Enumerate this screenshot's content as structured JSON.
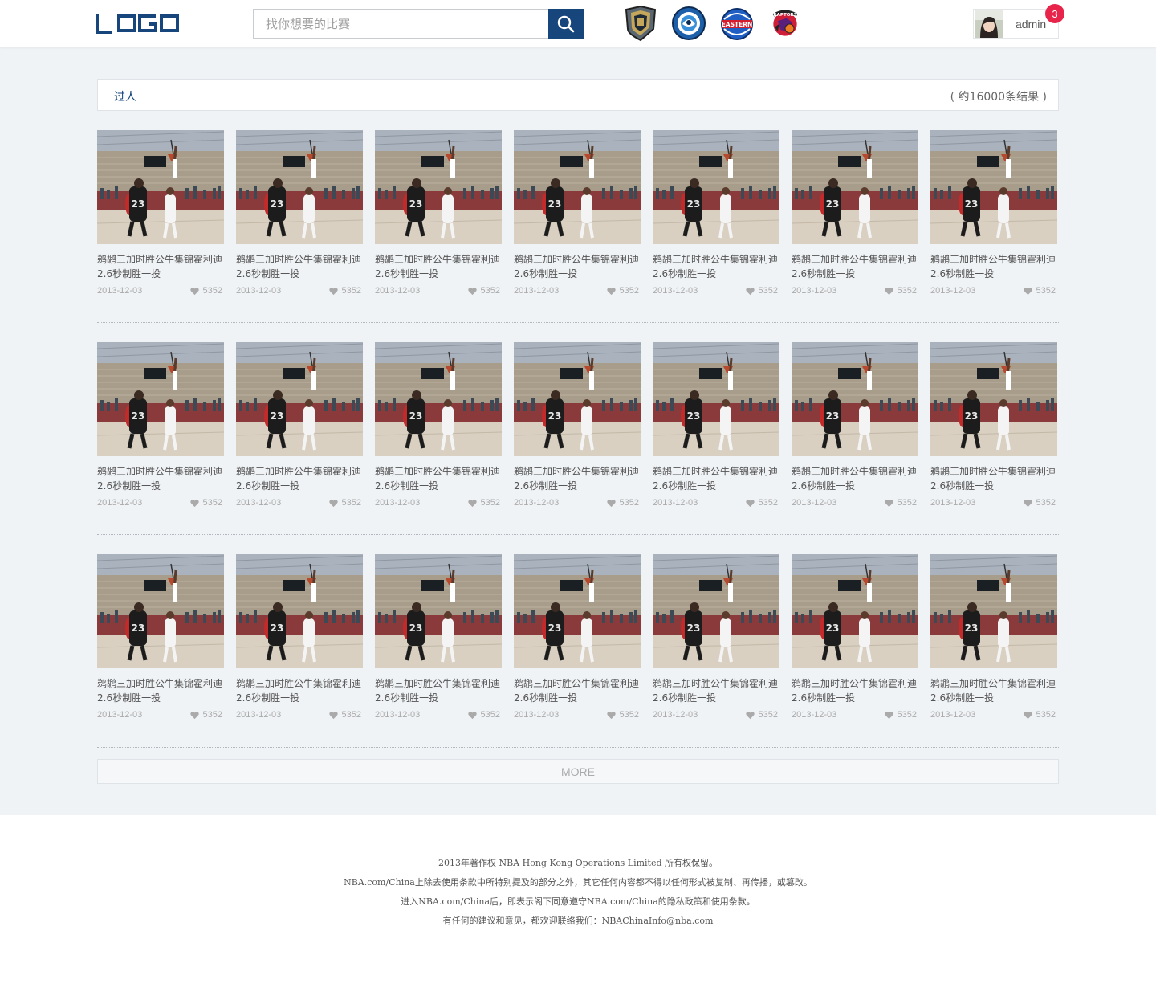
{
  "header": {
    "logo_text": "LOGO",
    "search": {
      "placeholder": "找你想要的比赛"
    },
    "teams": [
      {
        "name": "kings-emblem"
      },
      {
        "name": "hornets-emblem"
      },
      {
        "name": "eastern-emblem",
        "text": "EASTERN"
      },
      {
        "name": "raptors-emblem",
        "text": "RAPTORS"
      }
    ],
    "user": {
      "name": "admin",
      "notifications": "3"
    }
  },
  "results": {
    "keyword": "过人",
    "count_text": "( 约16000条结果 )"
  },
  "videos": [
    [
      {
        "title_line1": "鹈鹕三加时胜公牛集锦霍利迪",
        "title_line2": "2.6秒制胜一投",
        "date": "2013-12-03",
        "likes": "5352"
      },
      {
        "title_line1": "鹈鹕三加时胜公牛集锦霍利迪",
        "title_line2": "2.6秒制胜一投",
        "date": "2013-12-03",
        "likes": "5352"
      },
      {
        "title_line1": "鹈鹕三加时胜公牛集锦霍利迪",
        "title_line2": "2.6秒制胜一投",
        "date": "2013-12-03",
        "likes": "5352"
      },
      {
        "title_line1": "鹈鹕三加时胜公牛集锦霍利迪",
        "title_line2": "2.6秒制胜一投",
        "date": "2013-12-03",
        "likes": "5352"
      },
      {
        "title_line1": "鹈鹕三加时胜公牛集锦霍利迪",
        "title_line2": "2.6秒制胜一投",
        "date": "2013-12-03",
        "likes": "5352"
      },
      {
        "title_line1": "鹈鹕三加时胜公牛集锦霍利迪",
        "title_line2": "2.6秒制胜一投",
        "date": "2013-12-03",
        "likes": "5352"
      },
      {
        "title_line1": "鹈鹕三加时胜公牛集锦霍利迪",
        "title_line2": "2.6秒制胜一投",
        "date": "2013-12-03",
        "likes": "5352"
      }
    ],
    [
      {
        "title_line1": "鹈鹕三加时胜公牛集锦霍利迪",
        "title_line2": "2.6秒制胜一投",
        "date": "2013-12-03",
        "likes": "5352"
      },
      {
        "title_line1": "鹈鹕三加时胜公牛集锦霍利迪",
        "title_line2": "2.6秒制胜一投",
        "date": "2013-12-03",
        "likes": "5352"
      },
      {
        "title_line1": "鹈鹕三加时胜公牛集锦霍利迪",
        "title_line2": "2.6秒制胜一投",
        "date": "2013-12-03",
        "likes": "5352"
      },
      {
        "title_line1": "鹈鹕三加时胜公牛集锦霍利迪",
        "title_line2": "2.6秒制胜一投",
        "date": "2013-12-03",
        "likes": "5352"
      },
      {
        "title_line1": "鹈鹕三加时胜公牛集锦霍利迪",
        "title_line2": "2.6秒制胜一投",
        "date": "2013-12-03",
        "likes": "5352"
      },
      {
        "title_line1": "鹈鹕三加时胜公牛集锦霍利迪",
        "title_line2": "2.6秒制胜一投",
        "date": "2013-12-03",
        "likes": "5352"
      },
      {
        "title_line1": "鹈鹕三加时胜公牛集锦霍利迪",
        "title_line2": "2.6秒制胜一投",
        "date": "2013-12-03",
        "likes": "5352"
      }
    ],
    [
      {
        "title_line1": "鹈鹕三加时胜公牛集锦霍利迪",
        "title_line2": "2.6秒制胜一投",
        "date": "2013-12-03",
        "likes": "5352"
      },
      {
        "title_line1": "鹈鹕三加时胜公牛集锦霍利迪",
        "title_line2": "2.6秒制胜一投",
        "date": "2013-12-03",
        "likes": "5352"
      },
      {
        "title_line1": "鹈鹕三加时胜公牛集锦霍利迪",
        "title_line2": "2.6秒制胜一投",
        "date": "2013-12-03",
        "likes": "5352"
      },
      {
        "title_line1": "鹈鹕三加时胜公牛集锦霍利迪",
        "title_line2": "2.6秒制胜一投",
        "date": "2013-12-03",
        "likes": "5352"
      },
      {
        "title_line1": "鹈鹕三加时胜公牛集锦霍利迪",
        "title_line2": "2.6秒制胜一投",
        "date": "2013-12-03",
        "likes": "5352"
      },
      {
        "title_line1": "鹈鹕三加时胜公牛集锦霍利迪",
        "title_line2": "2.6秒制胜一投",
        "date": "2013-12-03",
        "likes": "5352"
      },
      {
        "title_line1": "鹈鹕三加时胜公牛集锦霍利迪",
        "title_line2": "2.6秒制胜一投",
        "date": "2013-12-03",
        "likes": "5352"
      }
    ]
  ],
  "more_label": "MORE",
  "footer": {
    "lines": [
      "2013年著作权 NBA Hong Kong Operations Limited 所有权保留。",
      "NBA.com/China上除去使用条款中所特别提及的部分之外，其它任何内容都不得以任何形式被复制、再传播，或篡改。",
      "进入NBA.com/China后，即表示阁下同意遵守NBA.com/China的隐私政策和使用条款。",
      "有任何的建议和意见，都欢迎联络我们：NBAChinaInfo@nba.com"
    ]
  },
  "colors": {
    "brand": "#16467c",
    "badge": "#e8244b",
    "page_bg": "#f0f3f6"
  }
}
